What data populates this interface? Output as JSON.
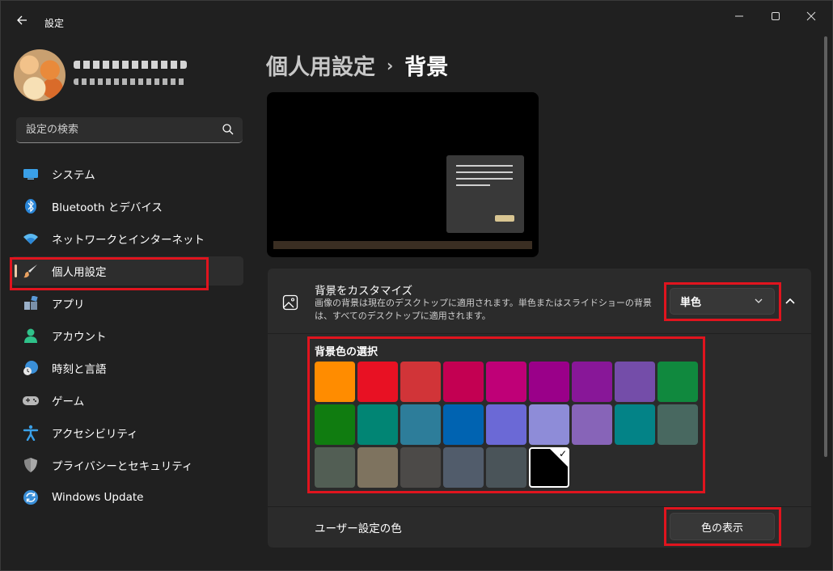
{
  "app": {
    "title": "設定",
    "back_icon": "arrow-left-icon",
    "window_controls": [
      "minimize-icon",
      "maximize-icon",
      "close-icon"
    ]
  },
  "search": {
    "placeholder": "設定の検索",
    "icon": "search-icon"
  },
  "sidebar": {
    "items": [
      {
        "label": "システム",
        "icon": "monitor-icon",
        "color": "#3aa0e8"
      },
      {
        "label": "Bluetooth とデバイス",
        "icon": "bluetooth-icon",
        "color": "#2a86d8"
      },
      {
        "label": "ネットワークとインターネット",
        "icon": "wifi-icon",
        "color": "#5bb8f0"
      },
      {
        "label": "個人用設定",
        "icon": "brush-icon",
        "color": "#e8a060",
        "active": true
      },
      {
        "label": "アプリ",
        "icon": "apps-icon",
        "color": "#9ab0c8"
      },
      {
        "label": "アカウント",
        "icon": "account-icon",
        "color": "#2fc28a"
      },
      {
        "label": "時刻と言語",
        "icon": "clock-globe-icon",
        "color": "#3a8fd8"
      },
      {
        "label": "ゲーム",
        "icon": "gamepad-icon",
        "color": "#b8b8b8"
      },
      {
        "label": "アクセシビリティ",
        "icon": "accessibility-icon",
        "color": "#3aa0e8"
      },
      {
        "label": "プライバシーとセキュリティ",
        "icon": "shield-icon",
        "color": "#a8a8a8"
      },
      {
        "label": "Windows Update",
        "icon": "update-icon",
        "color": "#3a8fd8"
      }
    ]
  },
  "header": {
    "parent": "個人用設定",
    "separator": "›",
    "current": "背景"
  },
  "background_card": {
    "title": "背景をカスタマイズ",
    "description": "画像の背景は現在のデスクトップに適用されます。単色またはスライドショーの背景は、すべてのデスクトップに適用されます。",
    "icon": "picture-icon",
    "dropdown_value": "単色",
    "collapse_icon": "chevron-up-icon",
    "swatch_label": "背景色の選択",
    "colors": [
      "#ff8c00",
      "#e81123",
      "#d13438",
      "#c30052",
      "#bf0077",
      "#9a0089",
      "#881798",
      "#744da9",
      "#10893e",
      "#107c10",
      "#018574",
      "#2d7d9a",
      "#0063b1",
      "#6b69d6",
      "#8e8cd8",
      "#8764b8",
      "#038387",
      "#486860",
      "#525e54",
      "#7e735f",
      "#4c4a48",
      "#515c6b",
      "#4a5459",
      "#000000"
    ],
    "selected_color": "#000000",
    "custom_label": "ユーザー設定の色",
    "show_color_button": "色の表示"
  }
}
